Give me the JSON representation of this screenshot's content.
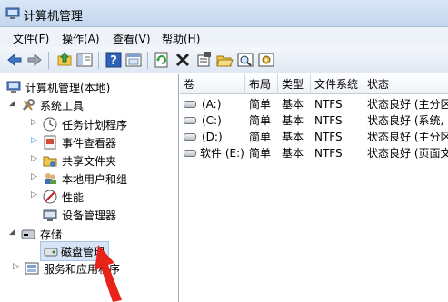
{
  "window": {
    "title": "计算机管理",
    "icon": "computer-management-icon"
  },
  "menu": [
    "文件(F)",
    "操作(A)",
    "查看(V)",
    "帮助(H)"
  ],
  "toolbar": {
    "icons": [
      "back-arrow-icon",
      "forward-arrow-icon",
      "up-folder-icon",
      "show-hide-tree-icon",
      "help-icon",
      "console-icon",
      "refresh-icon",
      "delete-icon",
      "properties-icon",
      "open-icon",
      "find-icon",
      "settings-icon"
    ]
  },
  "tree": {
    "root": "计算机管理(本地)",
    "system_tools": "系统工具",
    "task_scheduler": "任务计划程序",
    "event_viewer": "事件查看器",
    "shared_folders": "共享文件夹",
    "local_users": "本地用户和组",
    "performance": "性能",
    "device_manager": "设备管理器",
    "storage": "存储",
    "disk_management": "磁盘管理",
    "services": "服务和应用程序"
  },
  "table": {
    "columns": [
      "卷",
      "布局",
      "类型",
      "文件系统",
      "状态"
    ],
    "rows": [
      {
        "volume": "(A:)",
        "layout": "简单",
        "type": "基本",
        "fs": "NTFS",
        "status": "状态良好 (主分区"
      },
      {
        "volume": "(C:)",
        "layout": "简单",
        "type": "基本",
        "fs": "NTFS",
        "status": "状态良好 (系统,"
      },
      {
        "volume": "(D:)",
        "layout": "简单",
        "type": "基本",
        "fs": "NTFS",
        "status": "状态良好 (主分区"
      },
      {
        "volume": "软件 (E:)",
        "layout": "简单",
        "type": "基本",
        "fs": "NTFS",
        "status": "状态良好 (页面文"
      }
    ]
  },
  "colors": {
    "annotation_arrow": "#e8231a",
    "selected_row": "#d6e4f5"
  }
}
